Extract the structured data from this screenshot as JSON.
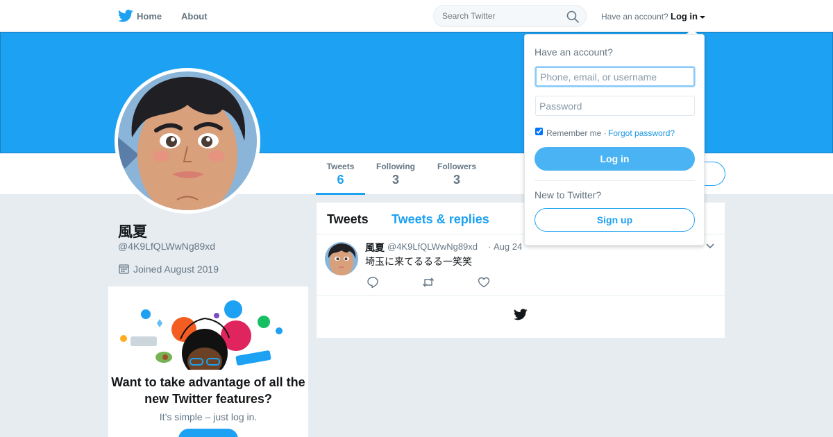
{
  "colors": {
    "brand": "#1da1f2",
    "text": "#14171a",
    "muted": "#657786",
    "bg": "#e6ecf0"
  },
  "nav": {
    "home_label": "Home",
    "about_label": "About",
    "search_placeholder": "Search Twitter",
    "have_account": "Have an account?",
    "login_label": "Log in",
    "logo_icon": "twitter-bird-icon",
    "search_icon": "search-icon"
  },
  "profile": {
    "name": "風夏",
    "handle": "@4K9LfQLWwNg89xd",
    "joined": "Joined August 2019"
  },
  "stats": [
    {
      "label": "Tweets",
      "value": "6"
    },
    {
      "label": "Following",
      "value": "3"
    },
    {
      "label": "Followers",
      "value": "3"
    }
  ],
  "promo": {
    "title": "Want to take advantage of all the new Twitter features?",
    "subtitle": "It’s simple – just log in."
  },
  "timeline": {
    "tabs": [
      "Tweets",
      "Tweets & replies"
    ],
    "tweet": {
      "name": "風夏",
      "handle": "@4K9LfQLWwNg89xd",
      "separator": "·",
      "date": "Aug 24",
      "text": "埼玉に来てるるる一笑笑"
    }
  },
  "login_dropdown": {
    "title": "Have an account?",
    "username_placeholder": "Phone, email, or username",
    "password_placeholder": "Password",
    "remember_label": "Remember me ·",
    "forgot_label": "Forgot password?",
    "login_button": "Log in",
    "new_label": "New to Twitter?",
    "signup_button": "Sign up"
  }
}
